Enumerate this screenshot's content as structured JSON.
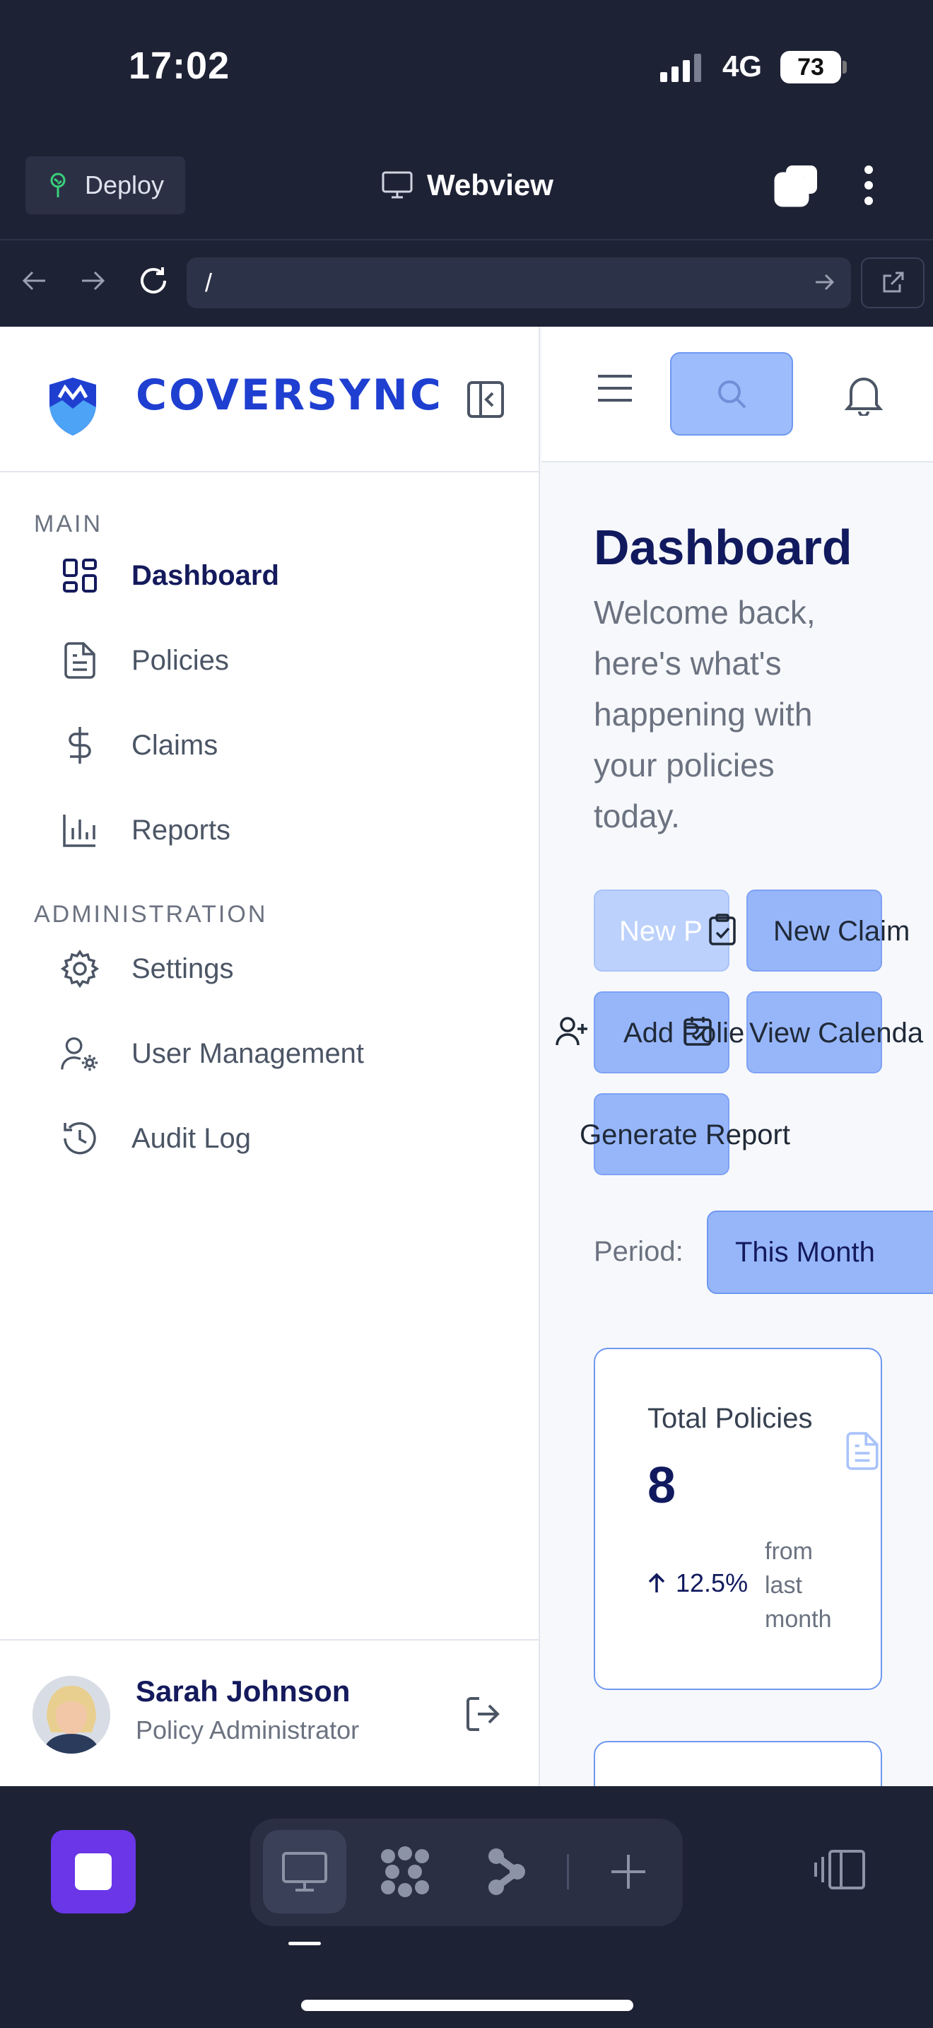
{
  "status_bar": {
    "time": "17:02",
    "network": "4G",
    "battery": "73"
  },
  "browser": {
    "deploy_label": "Deploy",
    "title": "Webview",
    "url": "/"
  },
  "sidebar": {
    "brand": "COVERSYNC",
    "main_heading": "MAIN",
    "main_items": [
      {
        "label": "Dashboard",
        "icon": "dashboard-icon",
        "active": true
      },
      {
        "label": "Policies",
        "icon": "document-icon"
      },
      {
        "label": "Claims",
        "icon": "dollar-icon"
      },
      {
        "label": "Reports",
        "icon": "bar-chart-icon"
      }
    ],
    "admin_heading": "ADMINISTRATION",
    "admin_items": [
      {
        "label": "Settings",
        "icon": "gear-icon"
      },
      {
        "label": "User Management",
        "icon": "user-cog-icon"
      },
      {
        "label": "Audit Log",
        "icon": "history-icon"
      }
    ],
    "user": {
      "name": "Sarah Johnson",
      "role": "Policy Administrator"
    }
  },
  "main": {
    "title": "Dashboard",
    "subtitle": "Welcome back, here's what's happening with your policies today.",
    "quick_actions": [
      {
        "label": "New P",
        "icon": "plus-icon"
      },
      {
        "label": "New Claim",
        "icon": "clipboard-check-icon"
      },
      {
        "label": "Add Polier",
        "icon": "user-plus-icon"
      },
      {
        "label": "View Calenda",
        "icon": "calendar-icon"
      },
      {
        "label": "Generate Report",
        "icon": "report-icon"
      }
    ],
    "period_label": "Period:",
    "period_value": "This Month",
    "stat_card": {
      "label": "Total Policies",
      "value": "8",
      "change": "12.5%",
      "change_note": "from last month"
    }
  },
  "colors": {
    "brand": "#1f3fd1",
    "accent_button": "#97b6fa",
    "dark_bg": "#1e2235",
    "app_icon": "#6a36e8"
  }
}
